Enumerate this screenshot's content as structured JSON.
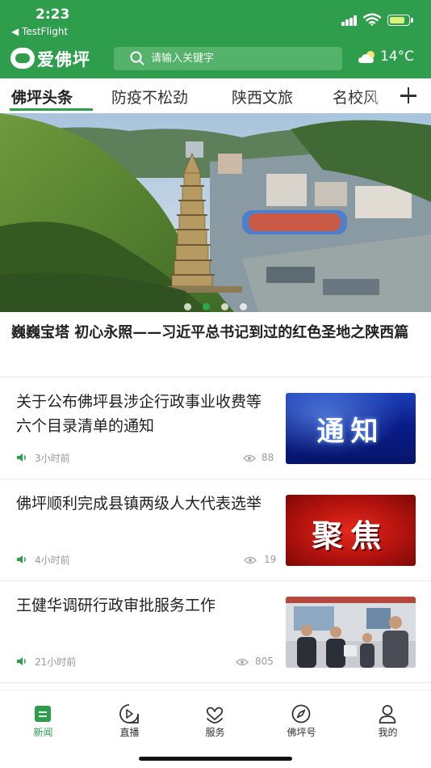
{
  "status_bar": {
    "time": "2:23",
    "back_app": "◀ TestFlight"
  },
  "header": {
    "app_name": "爱佛坪",
    "search_placeholder": "请输入关键字",
    "weather_temp": "14°C",
    "weather_icon": "partly-cloudy-icon"
  },
  "tabs": [
    {
      "label": "佛坪头条",
      "active": true
    },
    {
      "label": "防疫不松劲",
      "active": false
    },
    {
      "label": "陕西文旅",
      "active": false
    },
    {
      "label": "名校风",
      "active": false
    }
  ],
  "banner": {
    "image_icon": "pagoda-town-photo",
    "dot_count": 4,
    "active_dot": 1
  },
  "headline": "巍巍宝塔 初心永照——习近平总书记到过的红色圣地之陕西篇",
  "news": [
    {
      "title": "关于公布佛坪县涉企行政事业收费等六个目录清单的通知",
      "time": "3小时前",
      "views": "88",
      "thumb_text": "通知"
    },
    {
      "title": "佛坪顺利完成县镇两级人大代表选举",
      "time": "4小时前",
      "views": "19",
      "thumb_text": "聚焦"
    },
    {
      "title": "王健华调研行政审批服务工作",
      "time": "21小时前",
      "views": "805",
      "thumb_text": ""
    }
  ],
  "bottom_nav": [
    {
      "label": "新闻",
      "icon": "news-icon",
      "active": true
    },
    {
      "label": "直播",
      "icon": "live-play-icon",
      "active": false
    },
    {
      "label": "服务",
      "icon": "service-heart-icon",
      "active": false
    },
    {
      "label": "佛坪号",
      "icon": "compass-icon",
      "active": false
    },
    {
      "label": "我的",
      "icon": "user-icon",
      "active": false
    }
  ],
  "colors": {
    "brand_green": "#2e9e4c",
    "text_primary": "#222222",
    "text_meta": "#999999"
  }
}
